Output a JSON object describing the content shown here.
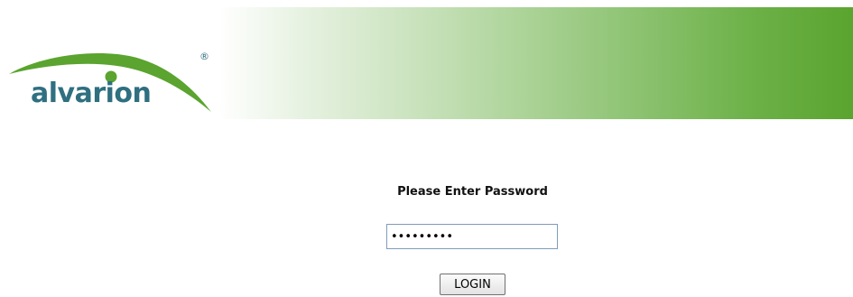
{
  "header": {
    "brand_name": "alvarion",
    "trademark": "®",
    "colors": {
      "brand_text": "#2f6f80",
      "brand_swoosh": "#5aa42f",
      "banner_green": "#5aa42f"
    }
  },
  "login_form": {
    "title": "Please Enter Password",
    "password_value": "•••••••••",
    "login_label": "LOGIN"
  }
}
